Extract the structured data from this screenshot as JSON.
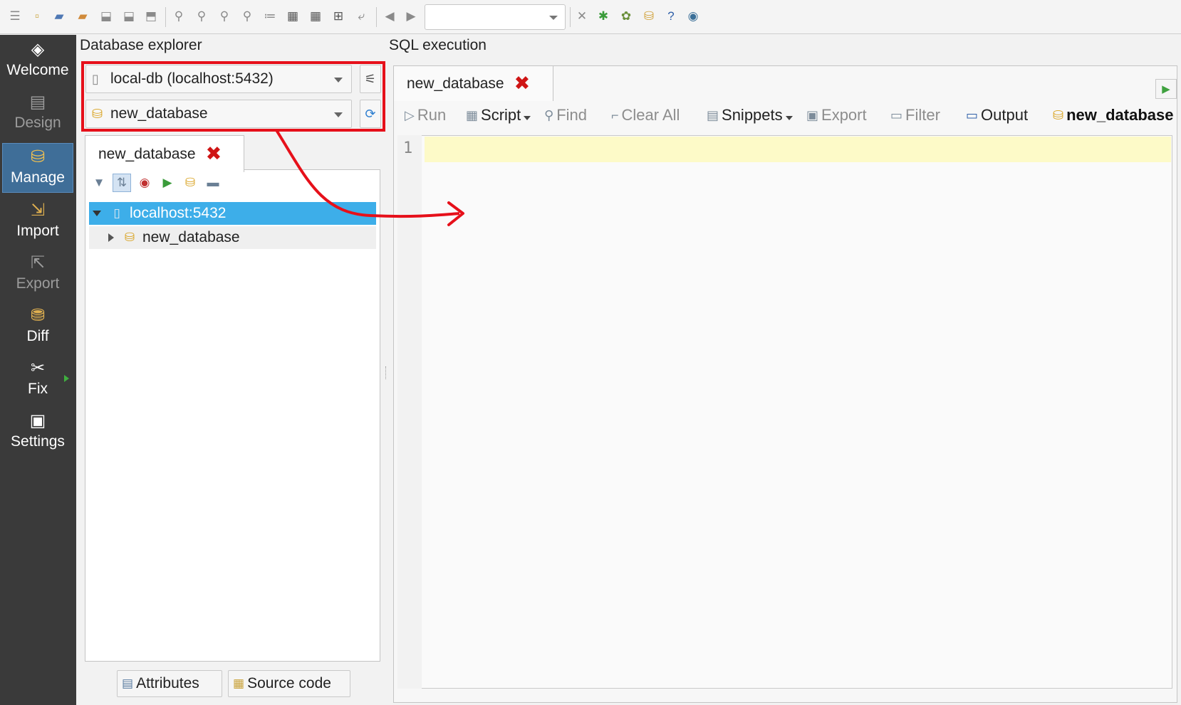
{
  "toolbar": {
    "icons": [
      "menu-icon",
      "new-file-icon",
      "open-folder-icon",
      "open-recent-icon",
      "save-icon",
      "save-as-icon",
      "export-file-icon",
      "find-icon",
      "find-next-icon",
      "find-prev-icon",
      "find-in-files-icon",
      "tree-view-icon",
      "grid-view-icon",
      "grid-layout-icon",
      "grid-fit-icon",
      "wrap-icon",
      "back-icon",
      "forward-icon"
    ],
    "combo_value": "",
    "right_icons": [
      "close-tab-icon",
      "plugins-icon",
      "debug-icon",
      "database-tools-icon",
      "help-icon",
      "about-icon"
    ]
  },
  "rail": {
    "items": [
      {
        "label": "Welcome",
        "icon": "welcome-icon",
        "state": "normal"
      },
      {
        "label": "Design",
        "icon": "design-icon",
        "state": "disabled"
      },
      {
        "label": "Manage",
        "icon": "manage-icon",
        "state": "active"
      },
      {
        "label": "Import",
        "icon": "import-icon",
        "state": "normal"
      },
      {
        "label": "Export",
        "icon": "export-icon",
        "state": "disabled"
      },
      {
        "label": "Diff",
        "icon": "diff-icon",
        "state": "normal"
      },
      {
        "label": "Fix",
        "icon": "fix-icon",
        "state": "normal"
      },
      {
        "label": "Settings",
        "icon": "settings-icon",
        "state": "normal"
      }
    ]
  },
  "explorer": {
    "title": "Database explorer",
    "connection": "local-db (localhost:5432)",
    "database": "new_database",
    "tab": "new_database",
    "tree": {
      "server": "localhost:5432",
      "database": "new_database"
    },
    "attributes_button": "Attributes",
    "source_button": "Source code"
  },
  "sql": {
    "title": "SQL execution",
    "tab": "new_database",
    "tools": {
      "run": "Run",
      "script": "Script",
      "find": "Find",
      "clear_all": "Clear All",
      "snippets": "Snippets",
      "export": "Export",
      "filter": "Filter",
      "output": "Output",
      "database": "new_database"
    },
    "line_number": "1"
  },
  "colors": {
    "highlight": "#e6101a",
    "selection": "#3daee9",
    "current_line": "#fdfac8",
    "rail": "#3a3a3a",
    "rail_active": "#3f6e98"
  }
}
